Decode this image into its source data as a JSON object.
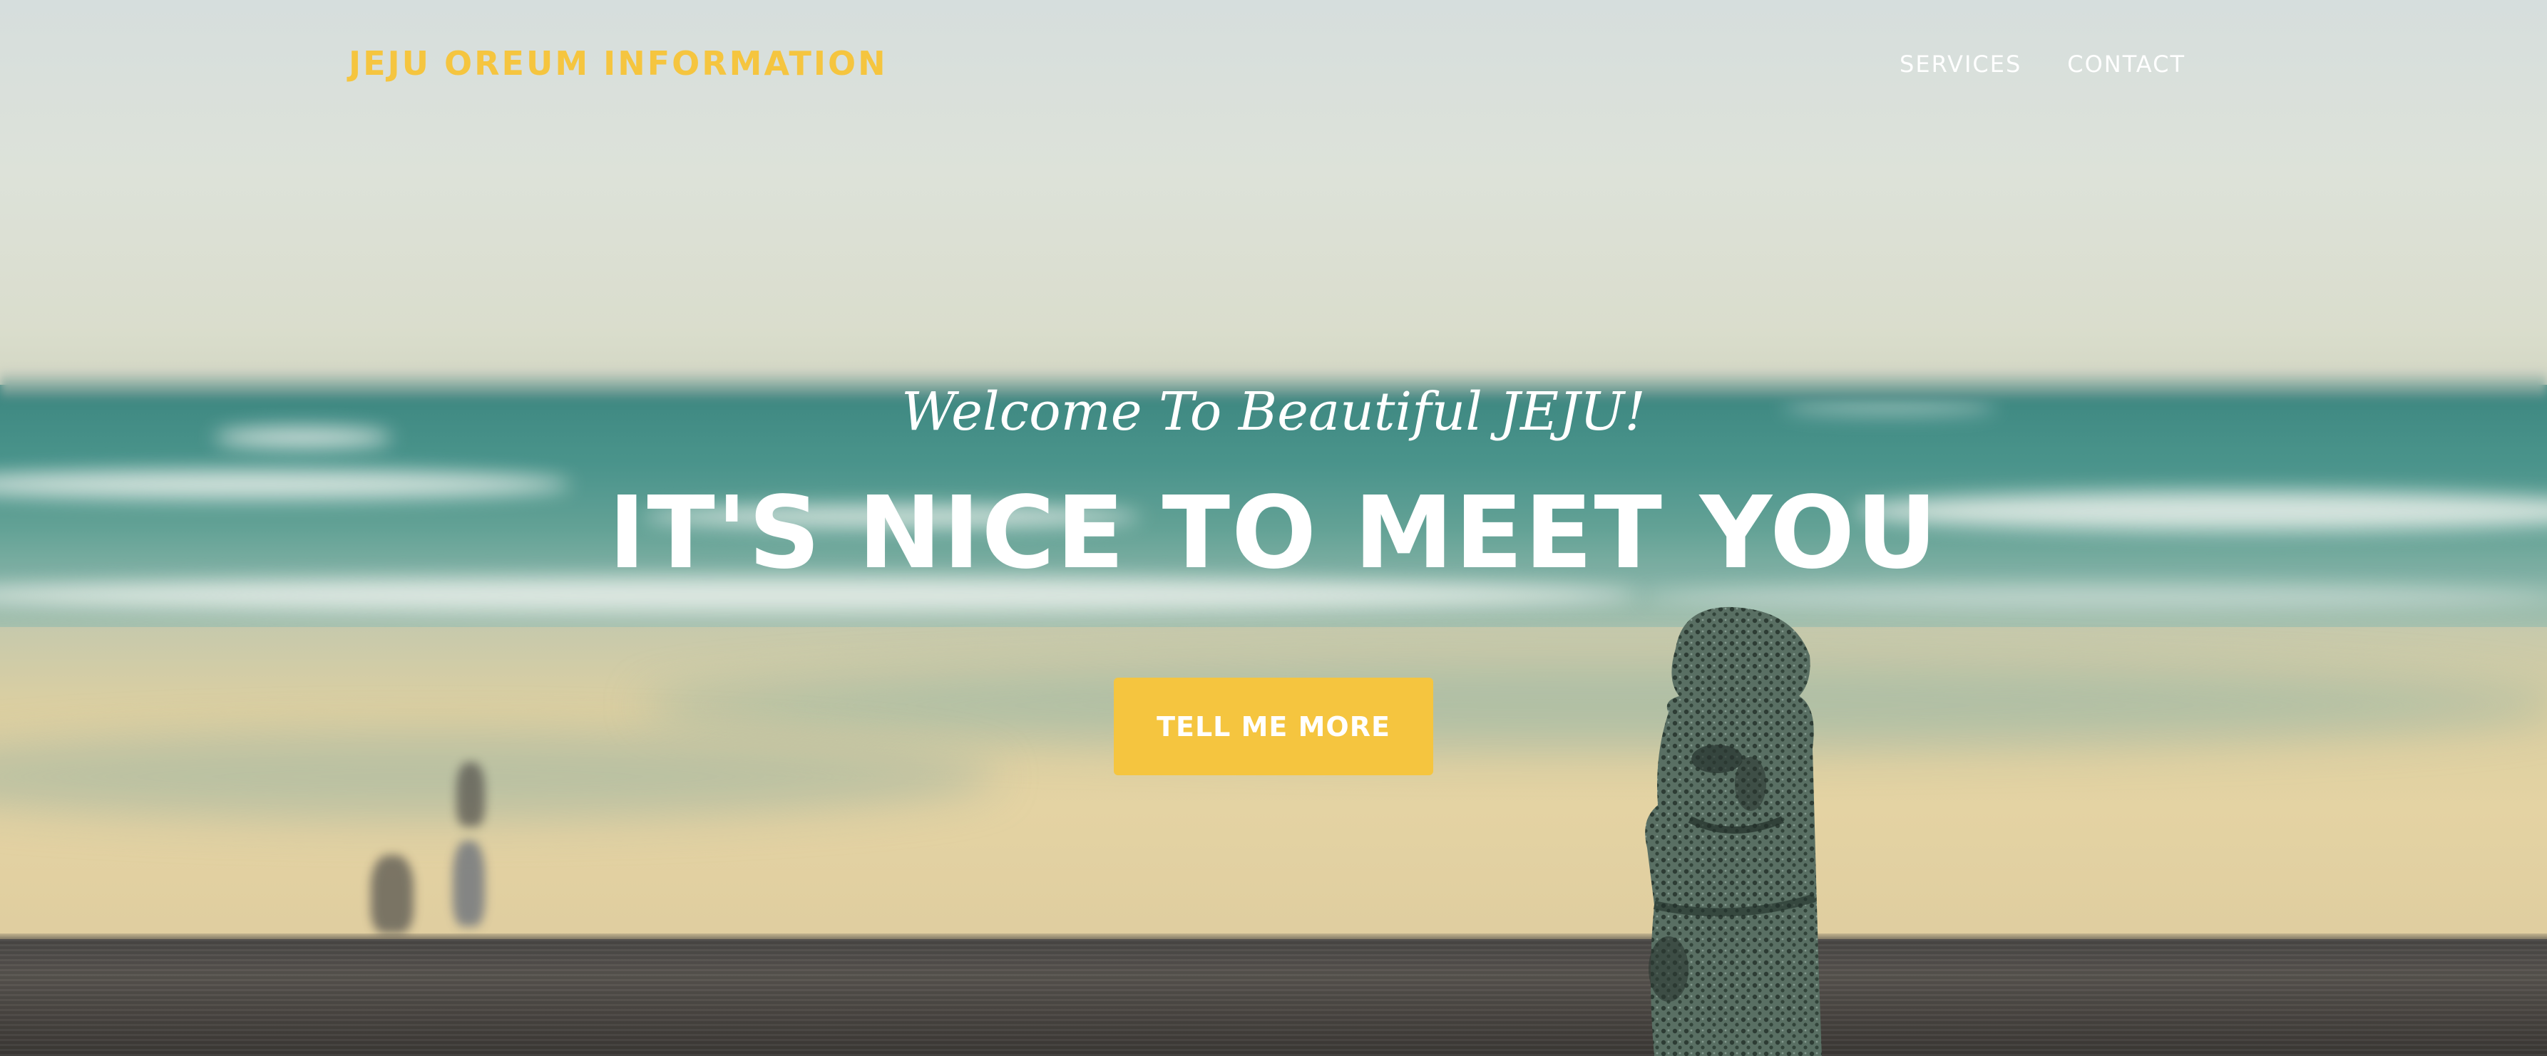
{
  "nav": {
    "brand": "JEJU OREUM INFORMATION",
    "links": [
      {
        "label": "SERVICES"
      },
      {
        "label": "CONTACT"
      }
    ]
  },
  "intro": {
    "lead_in": "Welcome To Beautiful JEJU!",
    "heading": "IT'S NICE TO MEET YOU",
    "button_label": "TELL ME MORE"
  },
  "colors": {
    "accent": "#f5c53f",
    "text_on_image": "#ffffff"
  }
}
